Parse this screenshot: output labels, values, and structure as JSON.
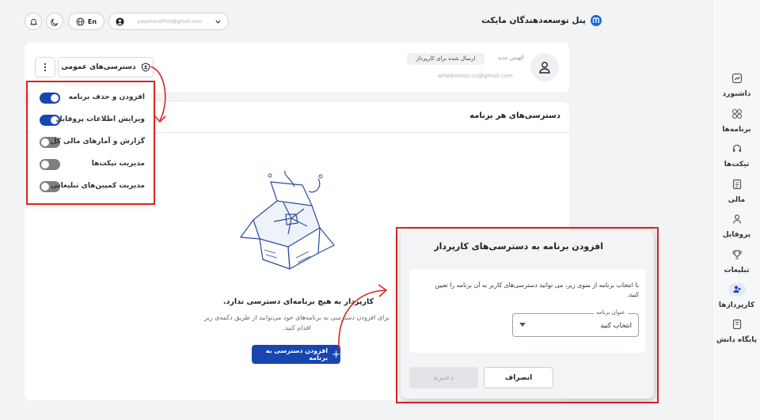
{
  "header": {
    "brand_title": "پنل توسعه‌دهندگان مایکت",
    "language": "En",
    "account_email": "yasamanafhmi@gmail.com"
  },
  "sidebar": {
    "items": [
      {
        "label": "داشبورد",
        "icon": "dashboard-icon"
      },
      {
        "label": "برنامه‌ها",
        "icon": "apps-icon"
      },
      {
        "label": "تیکت‌ها",
        "icon": "headset-icon"
      },
      {
        "label": "مالی",
        "icon": "document-icon"
      },
      {
        "label": "پروفایل",
        "icon": "profile-icon"
      },
      {
        "label": "تبلیغات",
        "icon": "trophy-icon"
      },
      {
        "label": "کارپردازها",
        "icon": "users-icon",
        "active": true
      },
      {
        "label": "پایگاه دانش",
        "icon": "book-icon"
      }
    ]
  },
  "user_card": {
    "name": "الهیس مدید",
    "badge": "ارسال شده برای کارپرداز",
    "email": "whalemoon.co@gmail.com",
    "public_access_label": "دسترسی‌های عمومی"
  },
  "permissions": [
    {
      "label": "افزودن و حذف برنامه",
      "enabled": true
    },
    {
      "label": "ویرایش اطلاعات پروفایل",
      "enabled": true
    },
    {
      "label": "گزارش و آمارهای مالی کل",
      "enabled": false
    },
    {
      "label": "مدیریت تیکت‌ها",
      "enabled": false
    },
    {
      "label": "مدیریت کمپین‌های تبلیغاتی",
      "enabled": false
    }
  ],
  "apps_section": {
    "title": "دسترسی‌های هر برنامه",
    "empty_title": "کارپرداز به هیچ برنامه‌ای دسترسی ندارد.",
    "empty_desc_line1": "برای افزودن دسترسی به برنامه‌های خود می‌توانید از طریق دکمه‌ی زیر",
    "empty_desc_line2": "اقدام کنید.",
    "add_button": "افزودن دسترسی به برنامه",
    "add_icon": "+"
  },
  "dialog": {
    "title": "افزودن برنامه به دسترسی‌های کارپرداز",
    "desc_line1": "با انتخاب برنامه از منوی زیر، می توانید دسترسی‌های کاربر به آن برنامه را تعیین",
    "desc_line2": "کنید.",
    "field_label": "عنوان برنامه",
    "field_placeholder": "انتخاب کنید",
    "cancel": "انصراف",
    "save": "ذخیره"
  },
  "colors": {
    "primary": "#1846b0",
    "highlight": "#d62626",
    "toggle_off": "#7d7f84"
  }
}
